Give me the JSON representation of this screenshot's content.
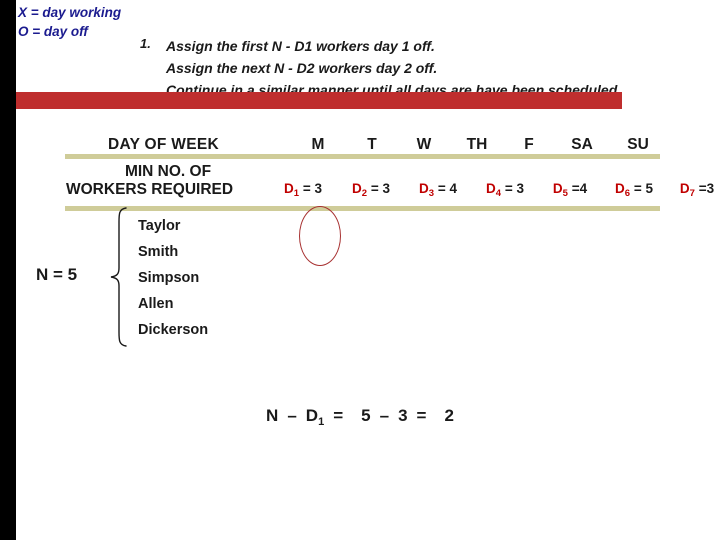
{
  "slide": {
    "legend": {
      "line1": "X = day working",
      "line2": "O = day off"
    },
    "instruction": {
      "number": "1.",
      "line1": "Assign the first N - D1  workers day 1 off.",
      "line2": "Assign the next N - D2 workers day 2 off.",
      "line3": "Continue in a similar manner until all days are have been scheduled."
    },
    "table": {
      "row_label_days": "DAY OF WEEK",
      "row_label_min_1": "MIN NO. OF",
      "row_label_min_2": "WORKERS REQUIRED",
      "days": [
        "M",
        "T",
        "W",
        "TH",
        "F",
        "SA",
        "SU"
      ],
      "requirements": [
        {
          "name": "D",
          "sub": "1",
          "eq": "= 3",
          "value": 3
        },
        {
          "name": "D",
          "sub": "2",
          "eq": "= 3",
          "value": 3
        },
        {
          "name": "D",
          "sub": "3",
          "eq": "= 4",
          "value": 4
        },
        {
          "name": "D",
          "sub": "4",
          "eq": "= 3",
          "value": 3
        },
        {
          "name": "D",
          "sub": "5",
          "eq": "=4",
          "value": 4
        },
        {
          "name": "D",
          "sub": "6",
          "eq": "= 5",
          "value": 5
        },
        {
          "name": "D",
          "sub": "7",
          "eq": "=3",
          "value": 3
        }
      ]
    },
    "workforce": {
      "n_label": "N = 5",
      "n_value": 5,
      "names": [
        "Taylor",
        "Smith",
        "Simpson",
        "Allen",
        "Dickerson"
      ]
    },
    "equation": {
      "lhs_n": "N",
      "minus": "–",
      "lhs_d": "D",
      "lhs_d_sub": "1",
      "eq1": "=",
      "rhs_a": "5",
      "minus2": "–",
      "rhs_b": "3",
      "eq2": "=",
      "result": "2",
      "full": "N – D1 =  5 – 3 =  2"
    },
    "colors": {
      "banner_red": "#bf2e2e",
      "rule_khaki": "#cfcc99",
      "legend_blue": "#1b1b8f",
      "d_label_red": "#c00000",
      "annotation_red": "#a83232",
      "side_bar": "#000000"
    },
    "annotation": {
      "shape": "ellipse",
      "target": "Monday column"
    }
  }
}
